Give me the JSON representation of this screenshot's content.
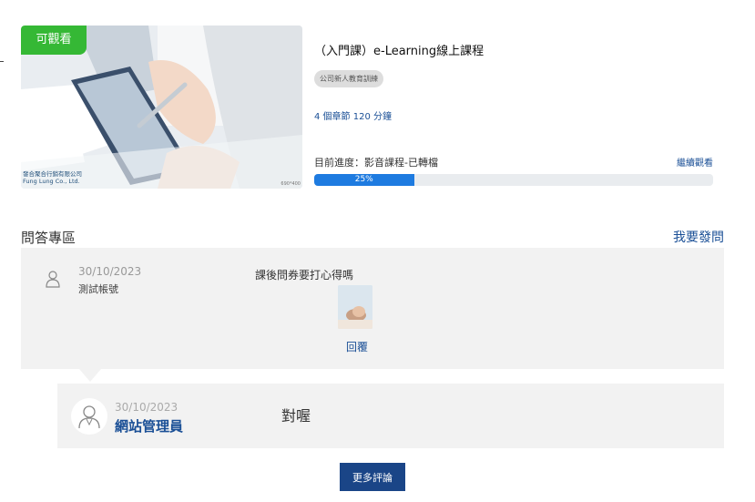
{
  "course": {
    "badge": "可觀看",
    "title": "（入門課）e-Learning線上課程",
    "tag": "公司新人教育訓練",
    "meta": "4 個章節  120 分鐘",
    "progress_label": "目前進度：影音課程-已轉檔",
    "continue_label": "繼續觀看",
    "progress_value": 25,
    "progress_text": "25%",
    "thumb_logo_line1": "發合聚合行銷有限公司",
    "thumb_logo_line2": "Fung Lung Co., Ltd.",
    "thumb_size_text": "690*400"
  },
  "qa": {
    "heading": "問答專區",
    "ask_label": "我要發問",
    "question": {
      "date": "30/10/2023",
      "user": "測試帳號",
      "text": "課後問券要打心得嗎",
      "reply_label": "回覆"
    },
    "answer": {
      "date": "30/10/2023",
      "user": "網站管理員",
      "text": "對喔"
    },
    "more_label": "更多評論"
  },
  "colors": {
    "accent_blue": "#1a4f96",
    "progress_blue": "#1e7be0",
    "badge_green": "#35b835",
    "button_navy": "#1a4587"
  },
  "icons": {
    "question_avatar": "user-outline-icon",
    "answer_avatar": "user-circle-icon"
  }
}
